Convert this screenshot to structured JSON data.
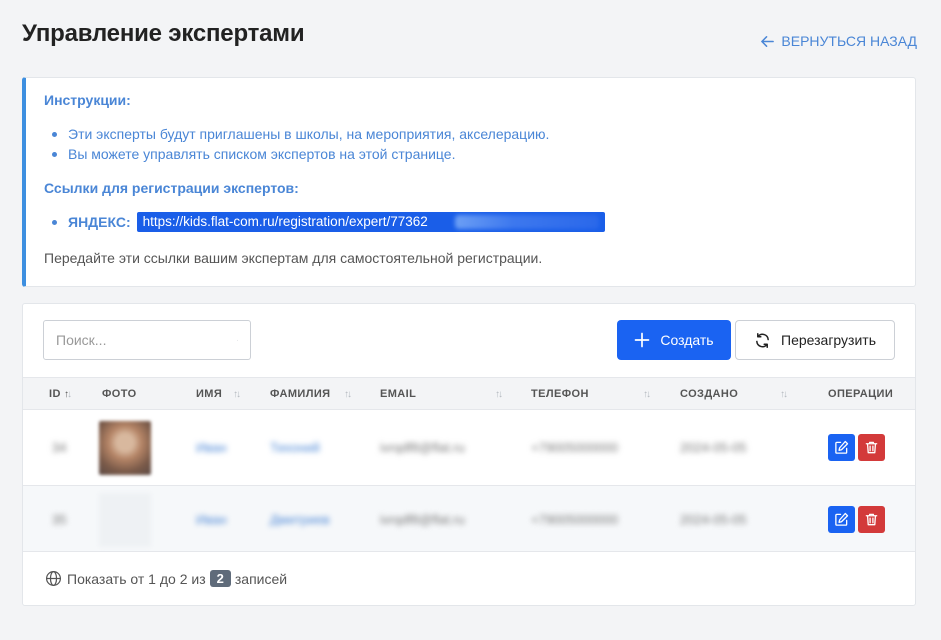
{
  "header": {
    "title": "Управление экспертами",
    "back_label": "ВЕРНУТЬСЯ НАЗАД"
  },
  "instructions": {
    "heading": "Инструкции:",
    "items": [
      "Эти эксперты будут приглашены в школы, на мероприятия, акселерацию.",
      "Вы можете управлять списком экспертов на этой странице."
    ],
    "links_heading": "Ссылки для регистрации экспертов:",
    "link_label": "ЯНДЕКС:",
    "link_url": "https://kids.flat-com.ru/registration/expert/77362",
    "note": "Передайте эти ссылки вашим экспертам для самостоятельной регистрации."
  },
  "toolbar": {
    "search_placeholder": "Поиск...",
    "create_label": "Создать",
    "reload_label": "Перезагрузить"
  },
  "table": {
    "columns": [
      "ID",
      "ФОТО",
      "ИМЯ",
      "ФАМИЛИЯ",
      "EMAIL",
      "ТЕЛЕФОН",
      "СОЗДАНО",
      "ОПЕРАЦИИ"
    ],
    "rows": [
      {
        "id": "34",
        "name": "Иван",
        "surname": "Тихоний",
        "email": "ivrqdf8@flat.ru",
        "phone": "+79005000000",
        "created": "2024-05-05"
      },
      {
        "id": "35",
        "name": "Иван",
        "surname": "Дмитриев",
        "email": "ivrqdf8@flat.ru",
        "phone": "+79005000000",
        "created": "2024-05-05"
      }
    ]
  },
  "footer": {
    "prefix": "Показать от 1 до 2 из",
    "count": "2",
    "suffix": "записей"
  },
  "colors": {
    "accent": "#1a63f2",
    "info_text": "#4a86d6",
    "delete": "#d33a3a"
  }
}
